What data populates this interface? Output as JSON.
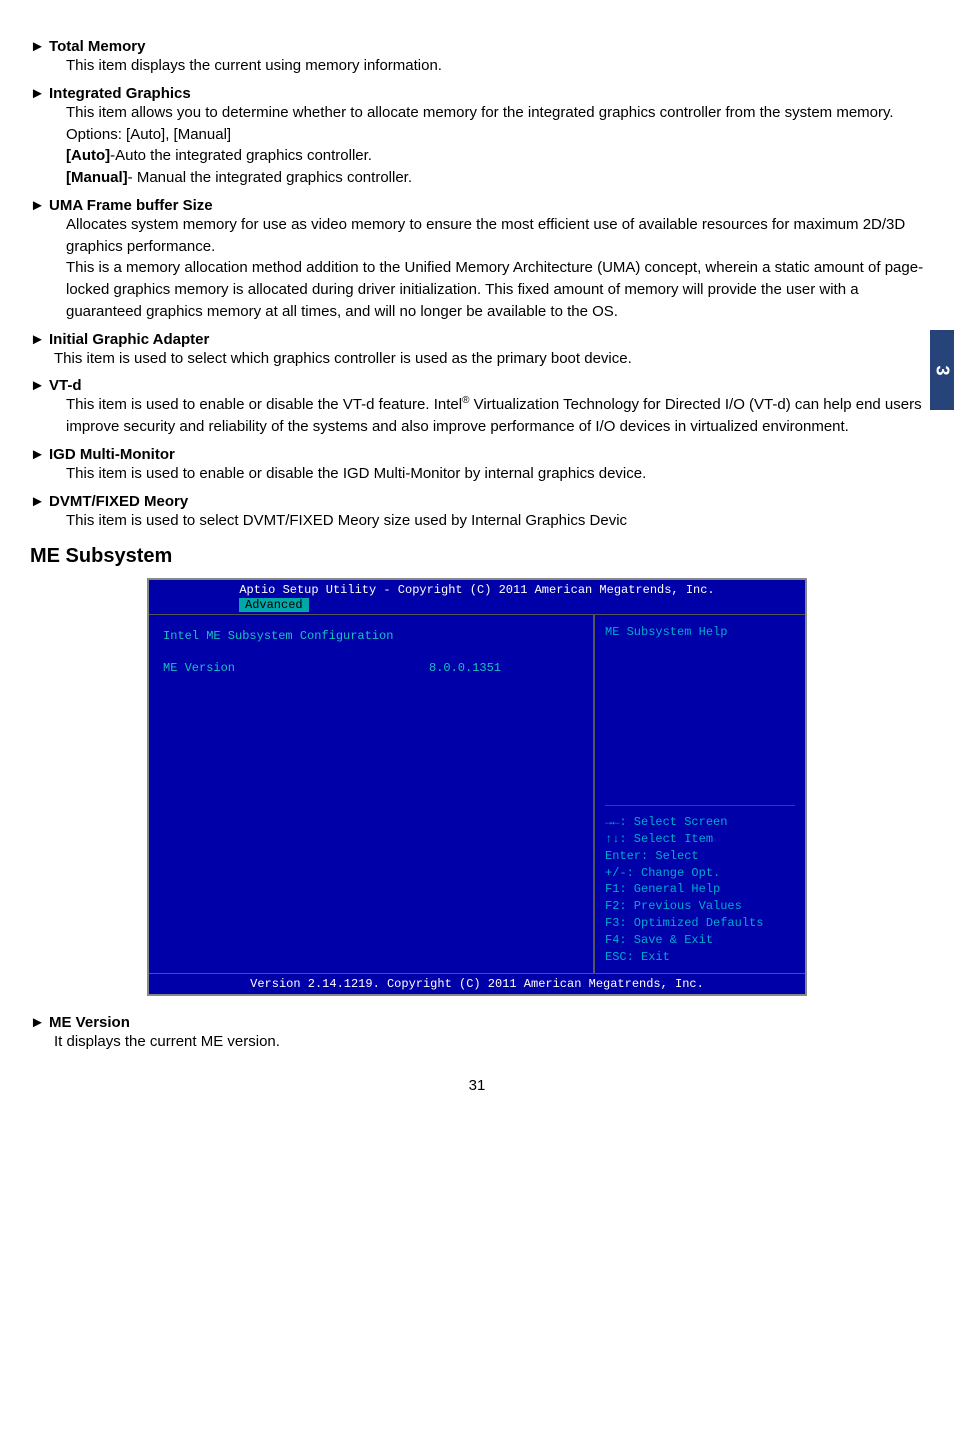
{
  "sideTab": "3",
  "items": [
    {
      "heading": "Total Memory",
      "paragraphs": [
        "This item displays the current using memory information."
      ]
    },
    {
      "heading": "Integrated Graphics",
      "paragraphs": [
        "This item allows you to determine whether to allocate memory for the integrated graphics controller from the system memory. Options: [Auto], [Manual]"
      ],
      "options": [
        {
          "label": "[Auto]",
          "desc": "-Auto the integrated graphics controller."
        },
        {
          "label": "[Manual]",
          "desc": "- Manual the integrated graphics controller."
        }
      ]
    },
    {
      "heading": "UMA Frame buffer Size",
      "paragraphs": [
        "Allocates system memory for use as video memory to ensure the most efficient use of available resources for maximum 2D/3D graphics performance.",
        "This is a memory allocation method addition to the Unified Memory Architecture (UMA) concept, wherein a static amount of page-locked graphics memory is allocated during driver initialization. This fixed amount of memory will provide the user with a guaranteed graphics memory at all times, and will no longer be available to the OS."
      ]
    },
    {
      "heading": "Initial Graphic Adapter",
      "paragraphs": [
        "This item is used to select which graphics controller is used as the primary boot device."
      ],
      "indent": "short"
    },
    {
      "heading": "VT-d",
      "paragraphs_html": "vtd"
    },
    {
      "heading": "IGD Multi-Monitor",
      "paragraphs": [
        "This item is used to enable or disable the IGD Multi-Monitor by internal graphics device."
      ]
    },
    {
      "heading": "DVMT/FIXED Meory",
      "paragraphs": [
        "This item is used to select DVMT/FIXED Meory size used by Internal Graphics Devic"
      ]
    }
  ],
  "vtd": {
    "pre": "This item is used to enable or disable the VT-d feature. Intel",
    "sup": "®",
    "post": " Virtualization Technology for Directed I/O (VT-d) can help end users improve security and reliability of the systems and also improve performance of I/O devices in virtualized environment."
  },
  "sectionTitle": "ME Subsystem",
  "bios": {
    "titleLine": "Aptio Setup Utility - Copyright (C) 2011 American Megatrends, Inc.",
    "tab": "Advanced",
    "leftLine1": "Intel ME Subsystem Configuration",
    "leftLine2Label": "ME Version",
    "leftLine2Value": "8.0.0.1351",
    "helpTop": "ME Subsystem Help",
    "keys": [
      "→←: Select Screen",
      "↑↓: Select Item",
      "Enter: Select",
      "+/-: Change Opt.",
      "F1: General Help",
      "F2: Previous Values",
      "F3: Optimized Defaults",
      "F4: Save & Exit",
      "ESC: Exit"
    ],
    "footer": "Version 2.14.1219. Copyright (C) 2011 American Megatrends, Inc."
  },
  "meVersion": {
    "heading": "ME Version",
    "body": "It displays the current ME version."
  },
  "pageNumber": "31"
}
